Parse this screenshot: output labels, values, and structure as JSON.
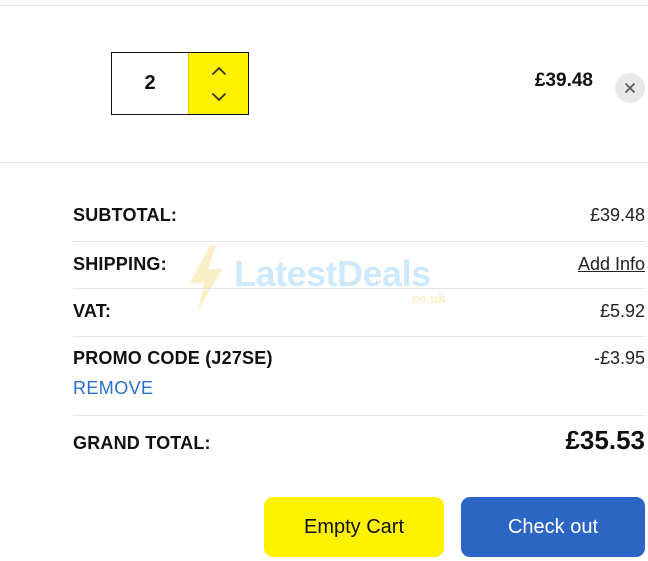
{
  "cart_item": {
    "quantity": "2",
    "line_price": "£39.48",
    "icons": {
      "increase": "chevron-up-icon",
      "decrease": "chevron-down-icon",
      "remove": "close-icon"
    }
  },
  "summary": {
    "subtotal": {
      "label": "SUBTOTAL:",
      "value": "£39.48"
    },
    "shipping": {
      "label": "SHIPPING:",
      "link": "Add Info"
    },
    "vat": {
      "label": "VAT:",
      "value": "£5.92"
    },
    "promo": {
      "label": "PROMO CODE (J27SE)",
      "value": "-£3.95",
      "remove": "REMOVE"
    },
    "grand_total": {
      "label": "GRAND TOTAL:",
      "value": "£35.53"
    }
  },
  "watermark": {
    "brand": "LatestDeals",
    "domain": ".co.uk"
  },
  "actions": {
    "empty_cart": "Empty Cart",
    "checkout": "Check out"
  },
  "colors": {
    "accent_yellow": "#fff200",
    "primary_blue": "#2c66c4",
    "link_blue": "#2a6fc9"
  }
}
